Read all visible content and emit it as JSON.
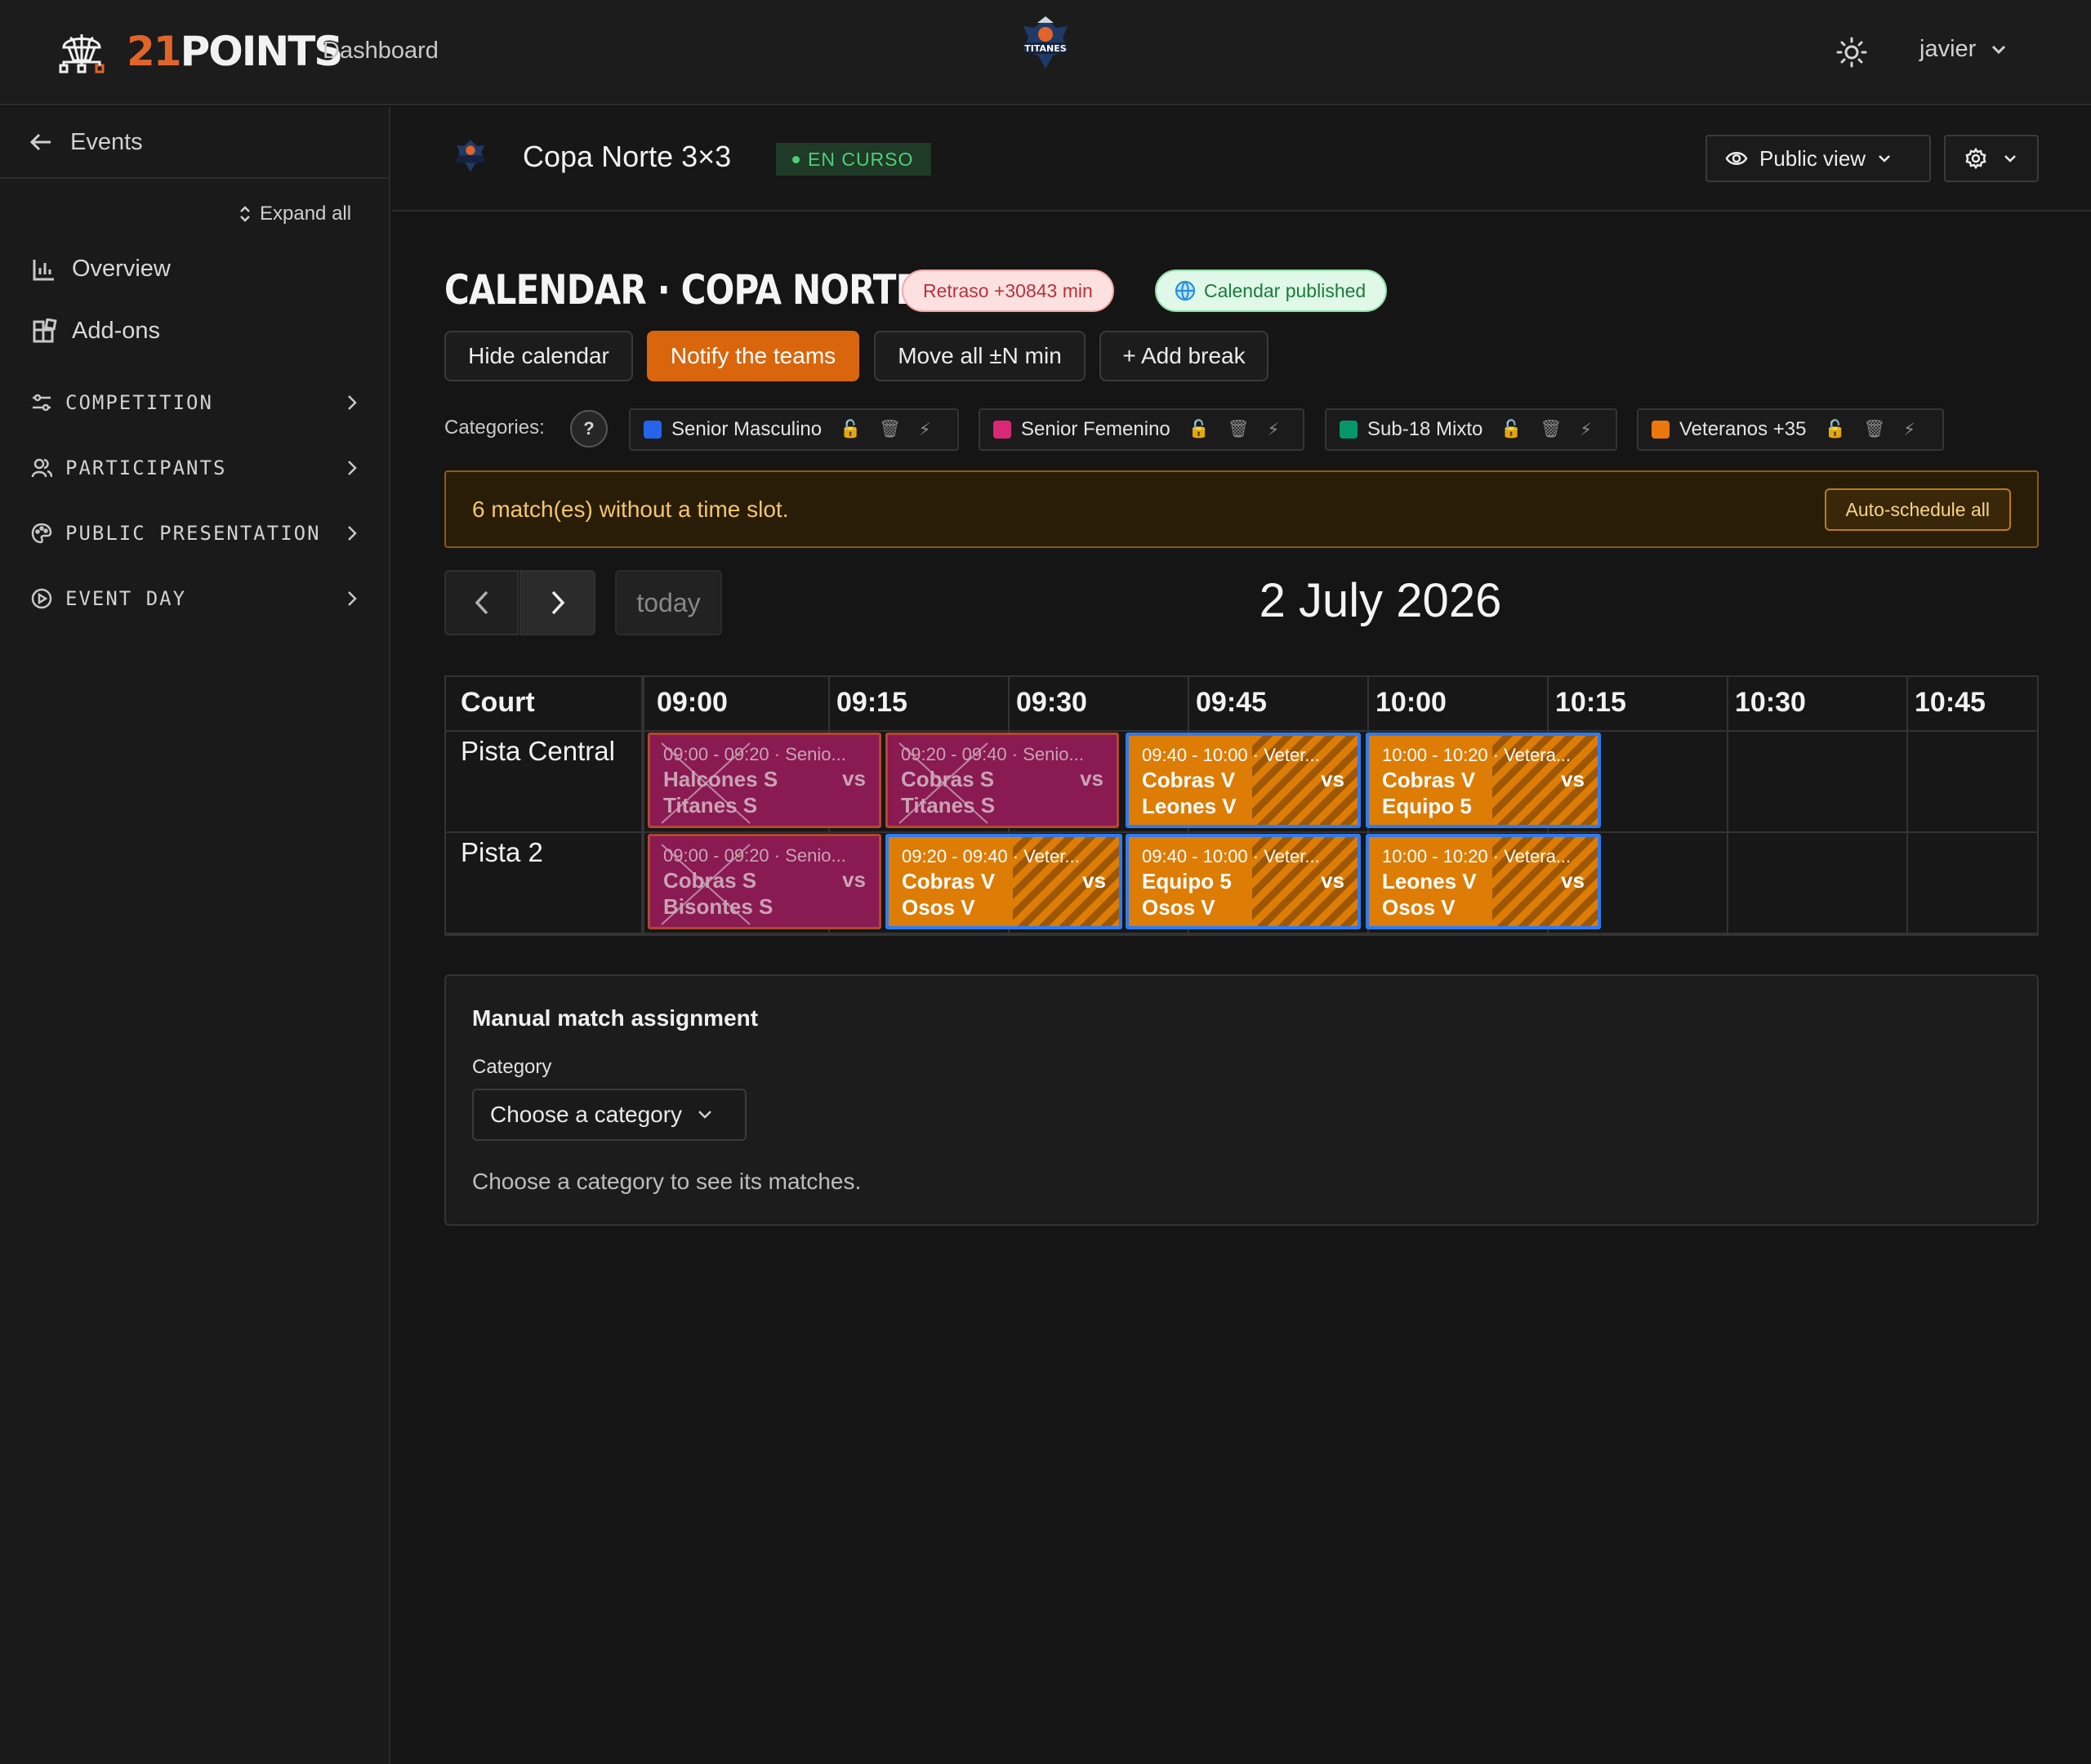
{
  "topbar": {
    "brand_num": "21",
    "brand_text": "POINTS",
    "nav_dashboard": "Dashboard",
    "team_logo_text": "TITANES",
    "user_name": "javier"
  },
  "sidebar": {
    "back_label": "Events",
    "expand_all": "Expand all",
    "links": [
      {
        "label": "Overview",
        "icon": "bar-chart-icon"
      },
      {
        "label": "Add-ons",
        "icon": "addons-icon"
      }
    ],
    "sections": [
      {
        "label": "COMPETITION",
        "icon": "sliders-icon"
      },
      {
        "label": "PARTICIPANTS",
        "icon": "users-icon"
      },
      {
        "label": "PUBLIC PRESENTATION",
        "icon": "palette-icon"
      },
      {
        "label": "EVENT DAY",
        "icon": "play-circle-icon"
      }
    ]
  },
  "event": {
    "title": "Copa Norte 3×3",
    "status": "EN CURSO",
    "public_view": "Public view"
  },
  "calendar": {
    "title": "CALENDAR · COPA NORTE 3X3",
    "delay_badge": "Retraso +30843 min",
    "published_badge": "Calendar published",
    "actions": {
      "hide": "Hide calendar",
      "notify": "Notify the teams",
      "move": "Move all ±N min",
      "add_break": "+ Add break"
    },
    "categories_label": "Categories:",
    "help": "?",
    "categories": [
      {
        "name": "Senior Masculino",
        "color": "#2563eb"
      },
      {
        "name": "Senior Femenino",
        "color": "#db2777"
      },
      {
        "name": "Sub-18 Mixto",
        "color": "#059669"
      },
      {
        "name": "Veteranos +35",
        "color": "#ea780c"
      }
    ],
    "warning": "6 match(es) without a time slot.",
    "autoschedule": "Auto-schedule all",
    "today": "today",
    "date": "2 July 2026",
    "grid": {
      "court_header": "Court",
      "times": [
        "09:00",
        "09:15",
        "09:30",
        "09:45",
        "10:00",
        "10:15",
        "10:30",
        "10:45"
      ],
      "rows": [
        "Pista Central",
        "Pista 2"
      ],
      "matches": [
        {
          "time": "09:00 - 09:20 · Senio...",
          "team1": "Halcones S",
          "team2": "Titanes S",
          "vs": "vs",
          "status": "cancelled"
        },
        {
          "time": "09:20 - 09:40 · Senio...",
          "team1": "Cobras S",
          "team2": "Titanes S",
          "vs": "vs",
          "status": "cancelled"
        },
        {
          "time": "09:40 - 10:00 · Veter...",
          "team1": "Cobras V",
          "team2": "Leones V",
          "vs": "vs",
          "status": "scheduled"
        },
        {
          "time": "10:00 - 10:20 · Vetera...",
          "team1": "Cobras V",
          "team2": "Equipo 5",
          "vs": "vs",
          "status": "scheduled"
        },
        {
          "time": "09:00 - 09:20 · Senio...",
          "team1": "Cobras S",
          "team2": "Bisontes S",
          "vs": "vs",
          "status": "cancelled"
        },
        {
          "time": "09:20 - 09:40 · Veter...",
          "team1": "Cobras V",
          "team2": "Osos V",
          "vs": "vs",
          "status": "scheduled"
        },
        {
          "time": "09:40 - 10:00 · Veter...",
          "team1": "Equipo 5",
          "team2": "Osos V",
          "vs": "vs",
          "status": "scheduled"
        },
        {
          "time": "10:00 - 10:20 · Vetera...",
          "team1": "Leones V",
          "team2": "Osos V",
          "vs": "vs",
          "status": "scheduled"
        }
      ]
    }
  },
  "manual": {
    "title": "Manual match assignment",
    "category_label": "Category",
    "select_value": "Choose a category",
    "hint": "Choose a category to see its matches."
  }
}
